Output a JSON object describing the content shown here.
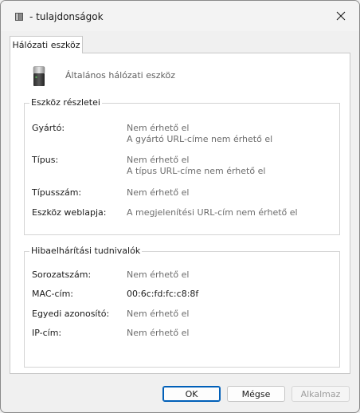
{
  "window": {
    "title": " - tulajdonságok",
    "title_icon": "book-icon",
    "close_icon": "close-icon"
  },
  "tabs": [
    {
      "label": "Hálózati eszköz"
    }
  ],
  "device": {
    "icon": "network-device-icon",
    "name": "Általános hálózati eszköz"
  },
  "details": {
    "title": "Eszköz részletei",
    "manufacturer": {
      "label": "Gyártó:",
      "value": "Nem érhető el",
      "url_value": "A gyártó URL-címe nem érhető el"
    },
    "type": {
      "label": "Típus:",
      "value": "Nem érhető el",
      "url_value": "A típus URL-címe nem érhető el"
    },
    "model_number": {
      "label": "Típusszám:",
      "value": "Nem érhető el"
    },
    "webpage": {
      "label": "Eszköz weblapja:",
      "value": "A megjelenítési URL-cím nem érhető el"
    }
  },
  "troubleshooting": {
    "title": "Hibaelhárítási tudnivalók",
    "serial": {
      "label": "Sorozatszám:",
      "value": "Nem érhető el"
    },
    "mac": {
      "label": "MAC-cím:",
      "value": "00:6c:fd:fc:c8:8f"
    },
    "unique_id": {
      "label": "Egyedi azonosító:",
      "value": "Nem érhető el"
    },
    "ip": {
      "label": "IP-cím:",
      "value": "Nem érhető el"
    }
  },
  "buttons": {
    "ok": "OK",
    "cancel": "Mégse",
    "apply": "Alkalmaz"
  }
}
